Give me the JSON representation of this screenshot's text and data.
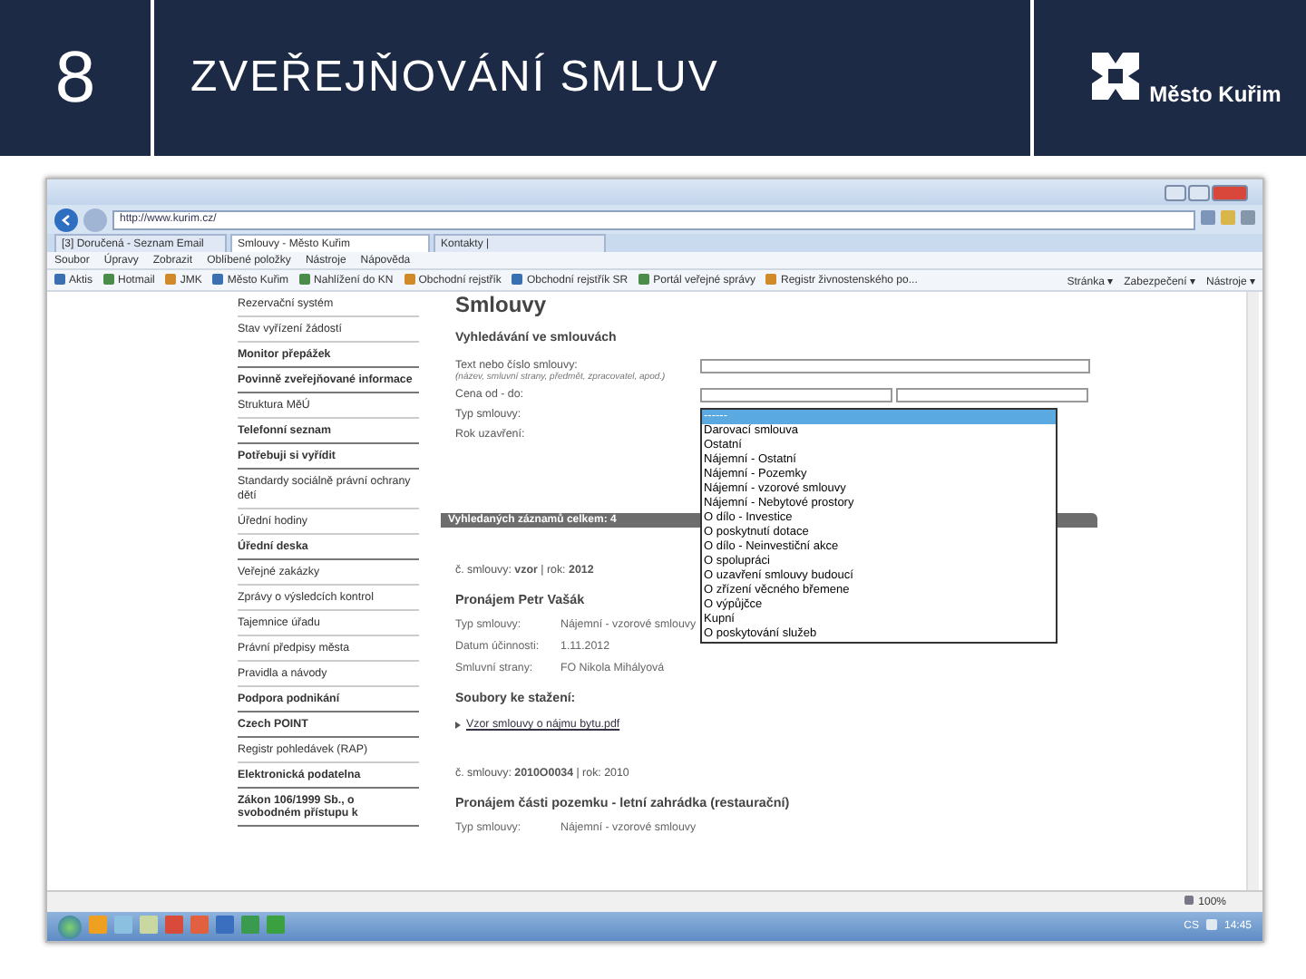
{
  "slide": {
    "number": "8",
    "title": "ZVEŘEJŇOVÁNÍ SMLUV",
    "logo_text": "Město Kuřim"
  },
  "browser": {
    "address": "http://www.kurim.cz/",
    "tabs": [
      {
        "label": "[3] Doručená - Seznam Email",
        "selected": false
      },
      {
        "label": "Smlouvy - Město Kuřim",
        "selected": true
      },
      {
        "label": "Kontakty |",
        "selected": false
      }
    ],
    "menu": [
      "Soubor",
      "Úpravy",
      "Zobrazit",
      "Oblíbené položky",
      "Nástroje",
      "Nápověda"
    ],
    "favorites": [
      "Aktis",
      "Hotmail",
      "JMK",
      "Město Kuřim",
      "Nahlížení do KN",
      "Obchodní rejstřík",
      "Obchodní rejstřík SR",
      "Portál veřejné správy",
      "Registr živnostenského po..."
    ],
    "commands": [
      "Stránka ▾",
      "Zabezpečení ▾",
      "Nástroje ▾"
    ]
  },
  "sidebar": {
    "items": [
      {
        "label": "Rezervační systém",
        "bold": false
      },
      {
        "label": "Stav vyřízení žádostí",
        "bold": false
      },
      {
        "label": "Monitor přepážek",
        "bold": true
      },
      {
        "label": "Povinně zveřejňované informace",
        "bold": true
      },
      {
        "label": "Struktura MěÚ",
        "bold": false
      },
      {
        "label": "Telefonní seznam",
        "bold": true
      },
      {
        "label": "Potřebuji si vyřídit",
        "bold": true
      },
      {
        "label": "Standardy sociálně právní ochrany dětí",
        "bold": false
      },
      {
        "label": "Úřední hodiny",
        "bold": false
      },
      {
        "label": "Úřední deska",
        "bold": true
      },
      {
        "label": "Veřejné zakázky",
        "bold": false
      },
      {
        "label": "Zprávy o výsledcích kontrol",
        "bold": false
      },
      {
        "label": "Tajemnice úřadu",
        "bold": false
      },
      {
        "label": "Právní předpisy města",
        "bold": false
      },
      {
        "label": "Pravidla a návody",
        "bold": false
      },
      {
        "label": "Podpora podnikání",
        "bold": true
      },
      {
        "label": "Czech POINT",
        "bold": true
      },
      {
        "label": "Registr pohledávek (RAP)",
        "bold": false
      },
      {
        "label": "Elektronická podatelna",
        "bold": true
      },
      {
        "label": "Zákon 106/1999 Sb., o svobodném přístupu k",
        "bold": true
      }
    ]
  },
  "search": {
    "heading": "Smlouvy",
    "subheading": "Vyhledávání ve smlouvách",
    "fields": [
      {
        "kind": "text",
        "label": "Text nebo číslo smlouvy:",
        "hint": "(název, smluvní strany, předmět, zpracovatel, apod.)"
      },
      {
        "kind": "range",
        "label": "Cena od - do:"
      },
      {
        "kind": "select",
        "label": "Typ smlouvy:"
      },
      {
        "kind": "plain",
        "label": "Rok uzavření:"
      }
    ],
    "dropdown": {
      "options": [
        {
          "label": "------",
          "selected": true
        },
        {
          "label": "Darovací smlouva",
          "selected": false
        },
        {
          "label": "Ostatní",
          "selected": false
        },
        {
          "label": "Nájemní - Ostatní",
          "selected": false
        },
        {
          "label": "Nájemní - Pozemky",
          "selected": false
        },
        {
          "label": "Nájemní - vzorové smlouvy",
          "selected": false
        },
        {
          "label": "Nájemní - Nebytové prostory",
          "selected": false
        },
        {
          "label": "O dílo - Investice",
          "selected": false
        },
        {
          "label": "O poskytnutí dotace",
          "selected": false
        },
        {
          "label": "O dílo - Neinvestiční akce",
          "selected": false
        },
        {
          "label": "O spolupráci",
          "selected": false
        },
        {
          "label": "O uzavření smlouvy budoucí",
          "selected": false
        },
        {
          "label": "O zřízení věcného břemene",
          "selected": false
        },
        {
          "label": "O výpůjčce",
          "selected": false
        },
        {
          "label": "Kupní",
          "selected": false
        },
        {
          "label": "O poskytování služeb",
          "selected": false
        }
      ]
    }
  },
  "results": {
    "summary": "Vyhledaných záznamů celkem: 4",
    "items": [
      {
        "meta": "č. smlouvy: **vzor** | rok: **2012**",
        "title": "Pronájem Petr Vašák",
        "details": [
          {
            "label": "Typ smlouvy:",
            "value": "Nájemní - vzorové smlouvy"
          },
          {
            "label": "Datum účinnosti:",
            "value": "1.11.2012"
          },
          {
            "label": "Smluvní strany:",
            "value": "FO Nikola Mihályová"
          }
        ],
        "files_heading": "Soubory ke stažení:",
        "files": [
          "Vzor smlouvy o nájmu bytu.pdf"
        ]
      },
      {
        "meta": "č. smlouvy: **2010O0034** | rok: 2010",
        "title": "Pronájem části pozemku - letní zahrádka (restaurační)",
        "details": [
          {
            "label": "Typ smlouvy:",
            "value": "Nájemní - vzorové smlouvy"
          }
        ]
      }
    ]
  },
  "status_bar": {
    "zoom": "100%"
  },
  "taskbar": {
    "language": "CS",
    "time": "14:45"
  }
}
